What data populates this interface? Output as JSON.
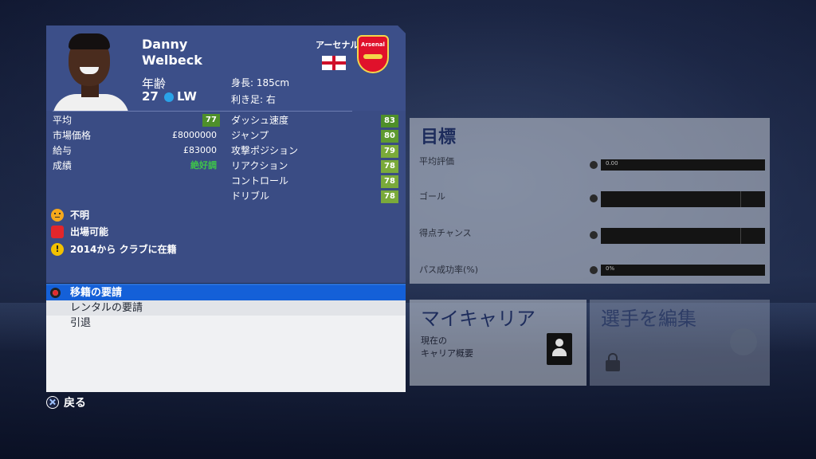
{
  "player": {
    "first_name": "Danny",
    "last_name": "Welbeck",
    "age_label": "年齢",
    "age": "27",
    "position": "LW",
    "height": "身長: 185cm",
    "preferred_foot": "利き足: 右",
    "club": "アーセナル",
    "club_crest_text": "Arsenal"
  },
  "left_stats": [
    {
      "label": "平均",
      "value": "77",
      "badge": true
    },
    {
      "label": "市場価格",
      "value": "£8000000"
    },
    {
      "label": "給与",
      "value": "£83000"
    },
    {
      "label": "成績",
      "value": "絶好調",
      "color": "#3ec44a"
    }
  ],
  "right_stats": [
    {
      "label": "ダッシュ速度",
      "value": "83"
    },
    {
      "label": "ジャンプ",
      "value": "80"
    },
    {
      "label": "攻撃ポジション",
      "value": "79"
    },
    {
      "label": "リアクション",
      "value": "78"
    },
    {
      "label": "コントロール",
      "value": "78"
    },
    {
      "label": "ドリブル",
      "value": "78"
    }
  ],
  "status": [
    {
      "icon": "morale-face-icon",
      "text": "不明"
    },
    {
      "icon": "fitness-icon",
      "text": "出場可能"
    },
    {
      "icon": "warning-icon",
      "text": "2014から クラブに在籍"
    }
  ],
  "menu": [
    {
      "label": "移籍の要請",
      "selected": true
    },
    {
      "label": "レンタルの要請"
    },
    {
      "label": "引退"
    }
  ],
  "back_label": "戻る",
  "goals": {
    "title": "目標",
    "items": [
      {
        "label": "平均評価",
        "bar_text": "0.00"
      },
      {
        "label": "ゴール",
        "bar_text": ""
      },
      {
        "label": "得点チャンス",
        "bar_text": ""
      },
      {
        "label": "パス成功率(%)",
        "bar_text": "0%"
      }
    ]
  },
  "tiles": {
    "career_title": "マイキャリア",
    "career_sub_1": "現在の",
    "career_sub_2": "キャリア概要",
    "edit_title": "選手を編集"
  },
  "colors": {
    "card": "#3a4c84",
    "menu_selected": "#1460d8",
    "rating_badge": "#4e8f2a",
    "form_good": "#3ec44a"
  }
}
